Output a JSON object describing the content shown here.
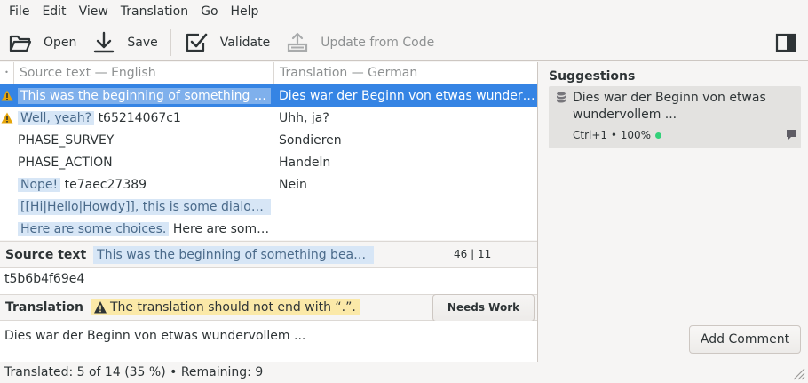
{
  "menubar": {
    "items": [
      "File",
      "Edit",
      "View",
      "Translation",
      "Go",
      "Help"
    ]
  },
  "toolbar": {
    "open_label": "Open",
    "save_label": "Save",
    "validate_label": "Validate",
    "update_label": "Update from Code"
  },
  "list": {
    "col_source": "Source text — English",
    "col_translation": "Translation — German",
    "rows": [
      {
        "warn": true,
        "src_hl": "This was the beginning of something bea…",
        "src_id": "",
        "translation": "Dies war der Beginn von etwas wundervoll…",
        "selected": true
      },
      {
        "warn": true,
        "src_hl": "Well, yeah?",
        "src_id": "t65214067c1",
        "translation": "Uhh, ja?"
      },
      {
        "warn": false,
        "src_hl": "",
        "src_id": "PHASE_SURVEY",
        "translation": "Sondieren"
      },
      {
        "warn": false,
        "src_hl": "",
        "src_id": "PHASE_ACTION",
        "translation": "Handeln"
      },
      {
        "warn": false,
        "src_hl": "Nope!",
        "src_id": "te7aec27389",
        "translation": "Nein"
      },
      {
        "warn": false,
        "src_hl": "[[Hi|Hello|Howdy]], this is some dialogue…",
        "src_id": "",
        "translation": ""
      },
      {
        "warn": false,
        "src_hl": "Here are some choices.",
        "src_id": "Here are some c…",
        "translation": ""
      }
    ]
  },
  "source_section": {
    "title": "Source text",
    "preview": "This was the beginning of something beautiful ...",
    "count": "46 | 11",
    "text": "t5b6b4f69e4"
  },
  "translation_section": {
    "title": "Translation",
    "warning": "The translation should not end with “.”.",
    "needs_work_label": "Needs Work",
    "text": "Dies war der Beginn von etwas wundervollem ..."
  },
  "suggestions": {
    "title": "Suggestions",
    "items": [
      {
        "text": "Dies war der Beginn von etwas wundervollem ...",
        "meta": "Ctrl+1 • 100%"
      }
    ],
    "add_comment_label": "Add Comment"
  },
  "statusbar": {
    "text": "Translated: 5 of 14 (35 %)  •  Remaining: 9"
  },
  "colors": {
    "accent": "#3584e4",
    "highlight": "#d7e6f6",
    "warning": "#fbe9a8",
    "ok": "#33d17a"
  }
}
